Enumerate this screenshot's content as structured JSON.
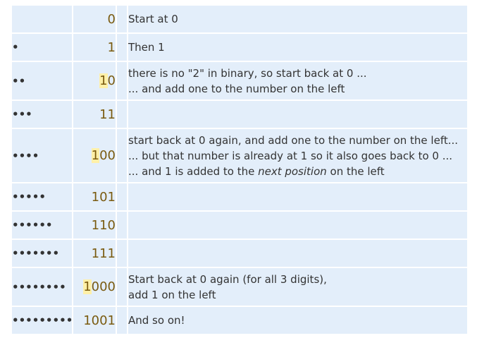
{
  "rows": [
    {
      "dots": "",
      "hl": "",
      "rest": "0",
      "notes": [
        "Start at 0"
      ]
    },
    {
      "dots": "•",
      "hl": "",
      "rest": "1",
      "notes": [
        "Then 1"
      ]
    },
    {
      "dots": "••",
      "hl": "1",
      "rest": "0",
      "notes": [
        "there is no \"2\" in binary, so start back at 0 ...",
        "... and add one to the number on the left"
      ]
    },
    {
      "dots": "•••",
      "hl": "",
      "rest": "11",
      "notes": []
    },
    {
      "dots": "••••",
      "hl": "1",
      "rest": "00",
      "notes": [
        "start back at 0 again, and add one to the number on the left...",
        "... but that number is already at 1 so it also goes back to 0 ...",
        "... and 1 is added to the {{next position}} on the left"
      ]
    },
    {
      "dots": "•••••",
      "hl": "",
      "rest": "101",
      "notes": []
    },
    {
      "dots": "••••••",
      "hl": "",
      "rest": "110",
      "notes": []
    },
    {
      "dots": "•••••••",
      "hl": "",
      "rest": "111",
      "notes": []
    },
    {
      "dots": "••••••••",
      "hl": "1",
      "rest": "000",
      "notes": [
        "Start back at 0 again (for all 3 digits),",
        "add 1 on the left"
      ]
    },
    {
      "dots": "•••••••••",
      "hl": "",
      "rest": "1001",
      "notes": [
        "And so on!"
      ]
    }
  ],
  "colors": {
    "row_bg": "#e3eefa",
    "number": "#7a5b10",
    "highlight": "#fff0a8"
  }
}
